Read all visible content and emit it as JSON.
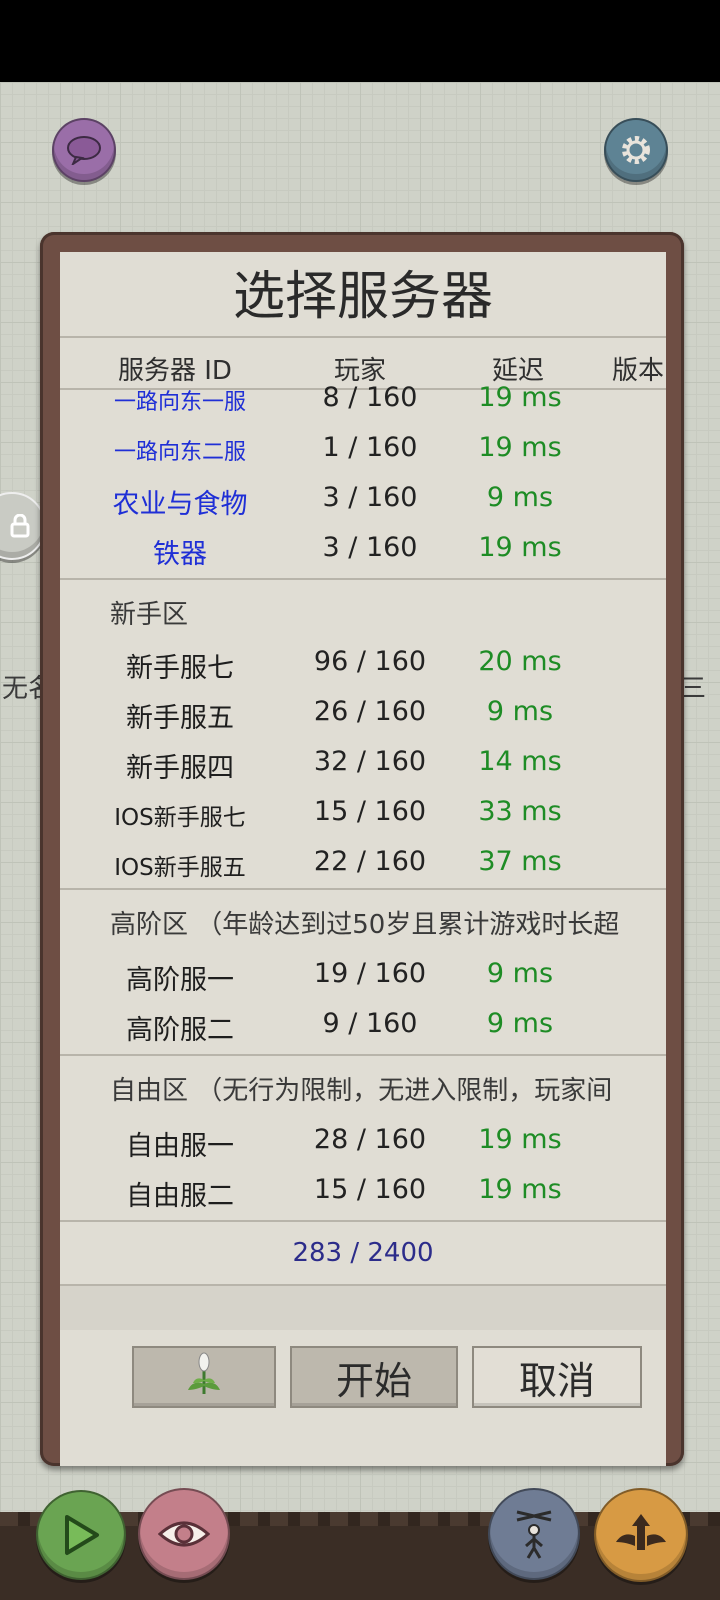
{
  "dialog": {
    "title": "选择服务器",
    "columns": [
      "服务器 ID",
      "玩家",
      "延迟",
      "版本"
    ],
    "top_servers": [
      {
        "name": "一路向东一服",
        "players": "8 / 160",
        "ping": "19 ms"
      },
      {
        "name": "一路向东二服",
        "players": "1 / 160",
        "ping": "19 ms"
      },
      {
        "name": "农业与食物",
        "players": "3 / 160",
        "ping": "9 ms"
      },
      {
        "name": "铁器",
        "players": "3 / 160",
        "ping": "19 ms"
      }
    ],
    "sections": [
      {
        "title": "新手区",
        "servers": [
          {
            "name": "新手服七",
            "players": "96 / 160",
            "ping": "20 ms"
          },
          {
            "name": "新手服五",
            "players": "26 / 160",
            "ping": "9 ms"
          },
          {
            "name": "新手服四",
            "players": "32 / 160",
            "ping": "14 ms"
          },
          {
            "name": "IOS新手服七",
            "players": "15 / 160",
            "ping": "33 ms"
          },
          {
            "name": "IOS新手服五",
            "players": "22 / 160",
            "ping": "37 ms"
          }
        ]
      },
      {
        "title": "高阶区 （年龄达到过50岁且累计游戏时长超",
        "servers": [
          {
            "name": "高阶服一",
            "players": "19 / 160",
            "ping": "9 ms"
          },
          {
            "name": "高阶服二",
            "players": "9 / 160",
            "ping": "9 ms"
          }
        ]
      },
      {
        "title": "自由区 （无行为限制，无进入限制，玩家间",
        "servers": [
          {
            "name": "自由服一",
            "players": "28 / 160",
            "ping": "19 ms"
          },
          {
            "name": "自由服二",
            "players": "15 / 160",
            "ping": "19 ms"
          }
        ]
      }
    ],
    "total": "283 / 2400",
    "buttons": {
      "start": "开始",
      "cancel": "取消"
    }
  },
  "background": {
    "left_text": "无名",
    "right_text": "三"
  },
  "colors": {
    "server_link": "#1f2fd6",
    "ping": "#1e8c25",
    "total": "#2c2c8a"
  },
  "icons": [
    "chat-icon",
    "gear-icon",
    "lock-icon",
    "plant-icon",
    "play-icon",
    "eye-icon",
    "puppet-icon",
    "winged-arrow-icon"
  ]
}
